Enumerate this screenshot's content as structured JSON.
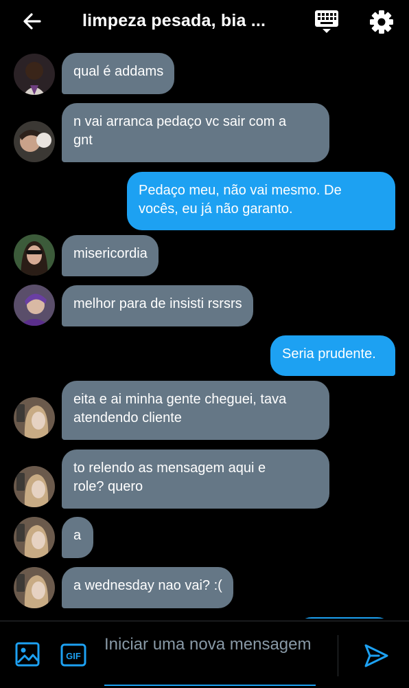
{
  "header": {
    "title": "limpeza pesada, bia ...",
    "back_icon": "arrow-left-icon",
    "keyboard_icon": "keyboard-icon",
    "settings_icon": "gear-icon"
  },
  "messages": [
    {
      "side": "in",
      "text": "qual é addams",
      "avatar": "avatar-1"
    },
    {
      "side": "in",
      "text": "n vai arranca pedaço vc sair com a\ngnt",
      "avatar": "avatar-2"
    },
    {
      "side": "out",
      "text": "Pedaço meu, não vai mesmo. De\nvocês, eu já não garanto."
    },
    {
      "side": "in",
      "text": "misericordia",
      "avatar": "avatar-3"
    },
    {
      "side": "in",
      "text": "melhor para de insisti rsrsrs",
      "avatar": "avatar-4"
    },
    {
      "side": "out",
      "text": "Seria prudente."
    },
    {
      "side": "in",
      "text": "eita e ai minha gente cheguei, tava\natendendo cliente",
      "avatar": "avatar-5"
    },
    {
      "side": "in",
      "text": "to relendo as mensagem aqui e\nrole? quero",
      "avatar": "avatar-5"
    },
    {
      "side": "in",
      "text": "a",
      "avatar": "avatar-5"
    },
    {
      "side": "in",
      "text": "a wednesday nao vai? :(",
      "avatar": "avatar-5"
    }
  ],
  "compose": {
    "placeholder": "Iniciar uma nova mensagem",
    "gif_label": "GIF",
    "image_icon": "image-icon",
    "send_icon": "send-icon"
  },
  "colors": {
    "background": "#000000",
    "incoming_bubble": "#657786",
    "outgoing_bubble": "#1da1f2",
    "accent": "#1da1f2"
  }
}
